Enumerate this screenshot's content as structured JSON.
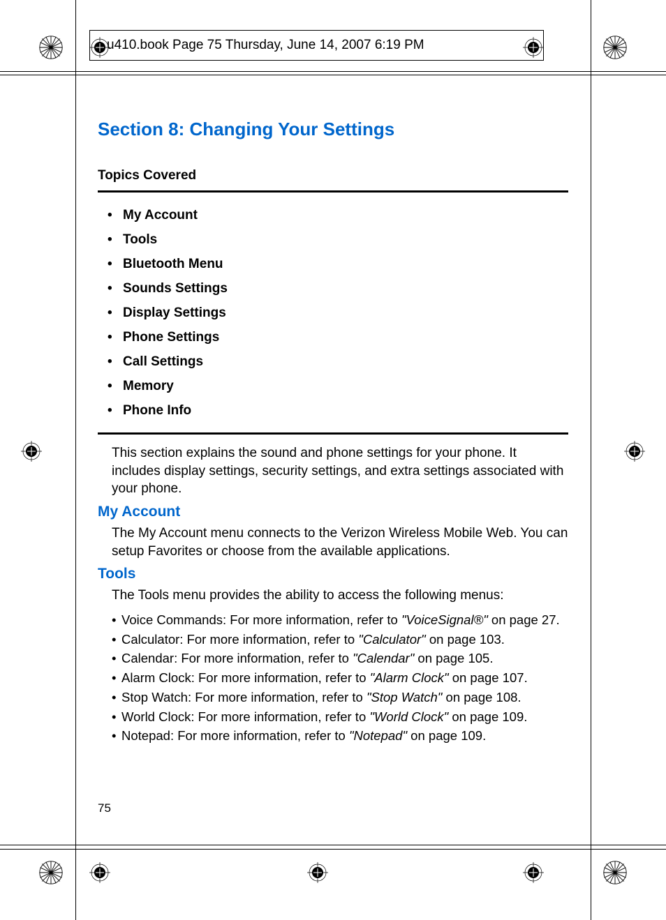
{
  "header": {
    "meta": "u410.book  Page 75  Thursday, June 14, 2007  6:19 PM"
  },
  "section": {
    "title": "Section 8: Changing Your Settings",
    "topics_heading": "Topics Covered",
    "topics": [
      "My Account",
      "Tools",
      "Bluetooth Menu",
      "Sounds Settings",
      "Display Settings",
      "Phone Settings",
      "Call Settings",
      "Memory",
      "Phone Info"
    ],
    "intro": "This section explains the sound and phone settings for your phone. It includes display settings, security settings, and extra settings associated with your phone."
  },
  "my_account": {
    "heading": "My Account",
    "body": "The My Account menu connects to the Verizon Wireless Mobile Web. You can setup Favorites or choose from the available applications."
  },
  "tools": {
    "heading": "Tools",
    "intro": "The Tools menu provides the ability to access the following menus:",
    "items": [
      {
        "label": "Voice Commands: For more information, refer to ",
        "ref": "\"VoiceSignal®\"",
        "after": "  on page 27."
      },
      {
        "label": "Calculator: For more information, refer to ",
        "ref": "\"Calculator\"",
        "after": "  on page 103."
      },
      {
        "label": "Calendar: For more information, refer to ",
        "ref": "\"Calendar\"",
        "after": "  on page 105."
      },
      {
        "label": "Alarm Clock: For more information, refer to ",
        "ref": "\"Alarm Clock\"",
        "after": "  on page 107."
      },
      {
        "label": "Stop Watch: For more information, refer to ",
        "ref": "\"Stop Watch\"",
        "after": "  on page 108."
      },
      {
        "label": "World Clock: For more information, refer to ",
        "ref": "\"World Clock\"",
        "after": "  on page 109."
      },
      {
        "label": "Notepad: For more information, refer to ",
        "ref": "\"Notepad\"",
        "after": "  on page 109."
      }
    ]
  },
  "page_number": "75"
}
